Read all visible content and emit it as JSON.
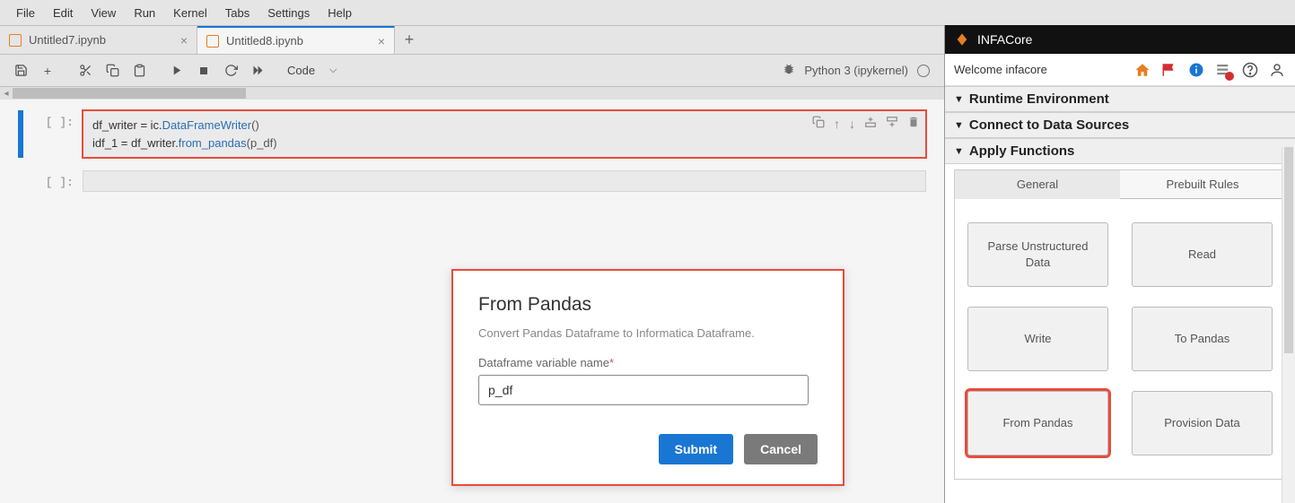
{
  "menubar": {
    "items": [
      "File",
      "Edit",
      "View",
      "Run",
      "Kernel",
      "Tabs",
      "Settings",
      "Help"
    ]
  },
  "tabs": {
    "items": [
      {
        "label": "Untitled7.ipynb",
        "active": false
      },
      {
        "label": "Untitled8.ipynb",
        "active": true
      }
    ]
  },
  "toolbar": {
    "celltype": "Code",
    "kernel_name": "Python 3 (ipykernel)"
  },
  "cells": {
    "c1": {
      "prompt": "[ ]:",
      "line1_pre": "df_writer = ic.",
      "line1_fn": "DataFrameWriter",
      "line1_post": "()",
      "line2_pre": "idf_1 = df_writer.",
      "line2_fn": "from_pandas",
      "line2_arg": "(p_df)"
    },
    "c2": {
      "prompt": "[ ]:"
    }
  },
  "dialog": {
    "title": "From Pandas",
    "desc": "Convert Pandas Dataframe to Informatica Dataframe.",
    "label": "Dataframe variable name",
    "req": "*",
    "value": "p_df",
    "submit": "Submit",
    "cancel": "Cancel"
  },
  "sidebar": {
    "brand": "INFACore",
    "welcome": "Welcome infacore",
    "sections": {
      "s1": "Runtime Environment",
      "s2": "Connect to Data Sources",
      "s3": "Apply Functions"
    },
    "fn_tabs": {
      "t1": "General",
      "t2": "Prebuilt Rules"
    },
    "fn_cards": {
      "c1": "Parse Unstructured Data",
      "c2": "Read",
      "c3": "Write",
      "c4": "To Pandas",
      "c5": "From Pandas",
      "c6": "Provision Data"
    }
  }
}
